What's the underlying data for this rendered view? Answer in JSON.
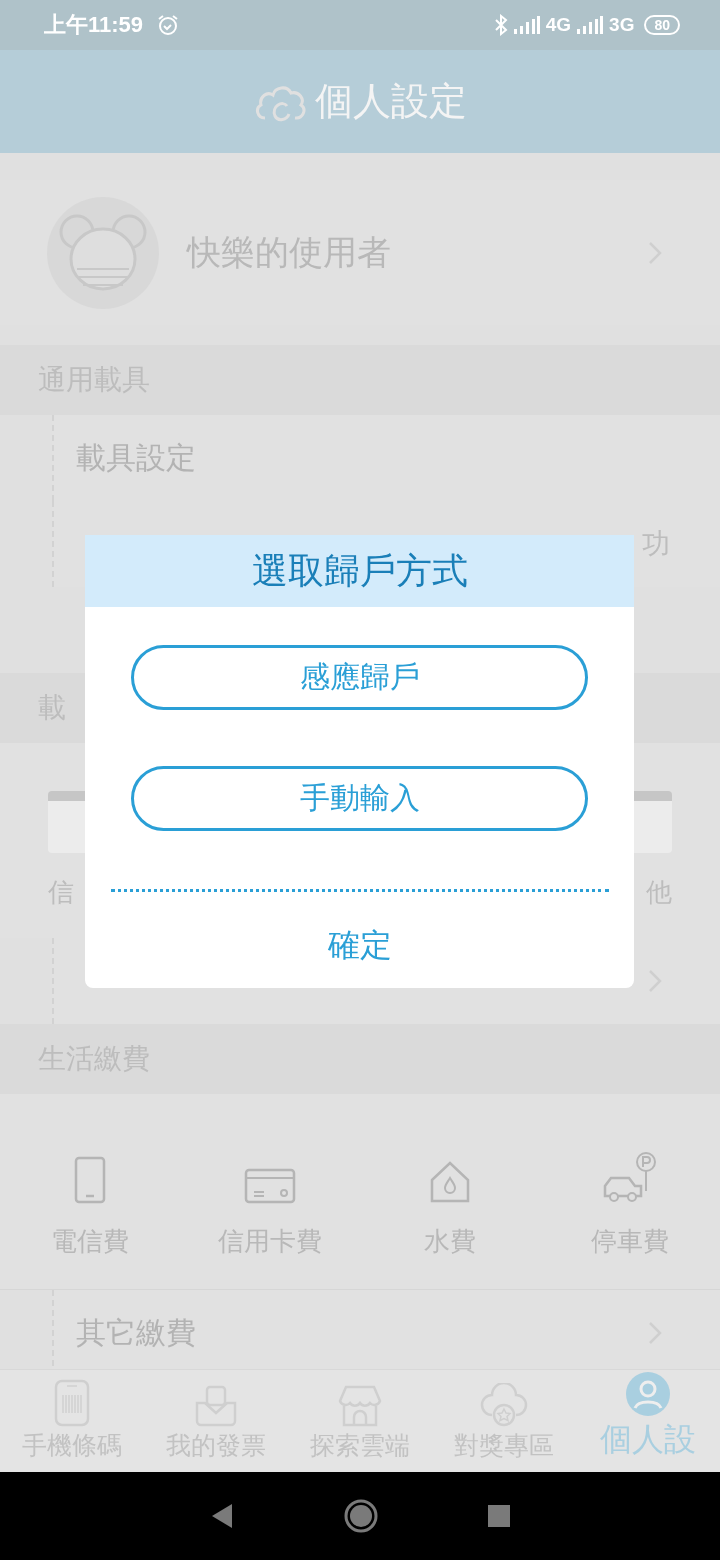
{
  "status_bar": {
    "time": "上午11:59",
    "network_1": "4G",
    "network_2": "3G",
    "battery": "80"
  },
  "header": {
    "title": "個人設定"
  },
  "profile": {
    "name": "快樂的使用者"
  },
  "sections": [
    {
      "title": "通用載具",
      "rows": [
        {
          "label": "載具設定",
          "chevron": false
        },
        {
          "value": "功",
          "chevron": false
        }
      ]
    },
    {
      "title": "載",
      "cards": [
        "信",
        "他"
      ],
      "rows": [
        {
          "chevron": true
        }
      ]
    },
    {
      "title": "生活繳費",
      "grid": [
        {
          "kind": "phone",
          "label": "電信費"
        },
        {
          "kind": "card",
          "label": "信用卡費"
        },
        {
          "kind": "water",
          "label": "水費"
        },
        {
          "kind": "parking",
          "label": "停車費"
        }
      ],
      "rows": [
        {
          "label": "其它繳費",
          "chevron": true
        }
      ]
    }
  ],
  "tabs": [
    {
      "kind": "barcode",
      "label": "手機條碼",
      "selected": false
    },
    {
      "kind": "mail",
      "label": "我的發票",
      "selected": false
    },
    {
      "kind": "store",
      "label": "探索雲端",
      "selected": false
    },
    {
      "kind": "cloud",
      "label": "對獎專區",
      "selected": false
    },
    {
      "kind": "person",
      "label": "個人設",
      "selected": true
    }
  ],
  "dialog": {
    "title": "選取歸戶方式",
    "options": [
      "感應歸戶",
      "手動輸入"
    ],
    "confirm": "確定"
  }
}
